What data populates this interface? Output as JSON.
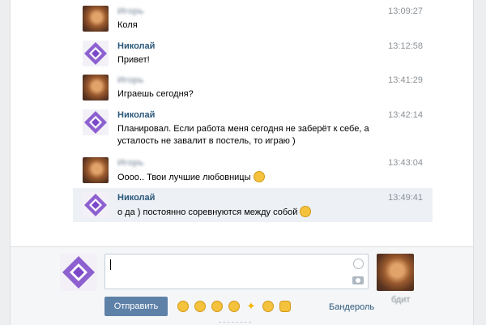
{
  "messages": [
    {
      "author": "Игорь",
      "author_blurred": true,
      "time": "13:09:27",
      "text": "Коля",
      "avatar": "brown-lion"
    },
    {
      "author": "Николай",
      "author_blurred": false,
      "time": "13:12:58",
      "text": "Привет!",
      "avatar": "purple-logo"
    },
    {
      "author": "Игорь",
      "author_blurred": true,
      "time": "13:41:29",
      "text": "Играешь сегодня?",
      "avatar": "brown-lion"
    },
    {
      "author": "Николай",
      "author_blurred": false,
      "time": "13:42:14",
      "text": "Планировал. Если работа меня сегодня не заберёт к себе, а",
      "text2": "усталость не завалит в постель, то играю )",
      "avatar": "purple-logo"
    },
    {
      "author": "Игорь",
      "author_blurred": true,
      "time": "13:43:04",
      "text": "Оооо.. Твои лучшие любовницы",
      "emoji": "grin",
      "avatar": "brown-lion"
    },
    {
      "author": "Николай",
      "author_blurred": false,
      "time": "13:49:41",
      "text": "о да ) постоянно соревнуются между собой",
      "emoji": "laugh",
      "avatar": "purple-logo",
      "highlighted": true
    }
  ],
  "composer": {
    "input_value": "",
    "send_label": "Отправить",
    "banderol_label": "Бандероль",
    "typing_label": "бдит",
    "quick_emojis": [
      "laugh",
      "grin",
      "angry",
      "cry",
      "sparkles",
      "smile",
      "pray"
    ]
  },
  "colors": {
    "author": "#2b587a",
    "send_button": "#5e81a8",
    "highlight": "#edf0f5"
  }
}
